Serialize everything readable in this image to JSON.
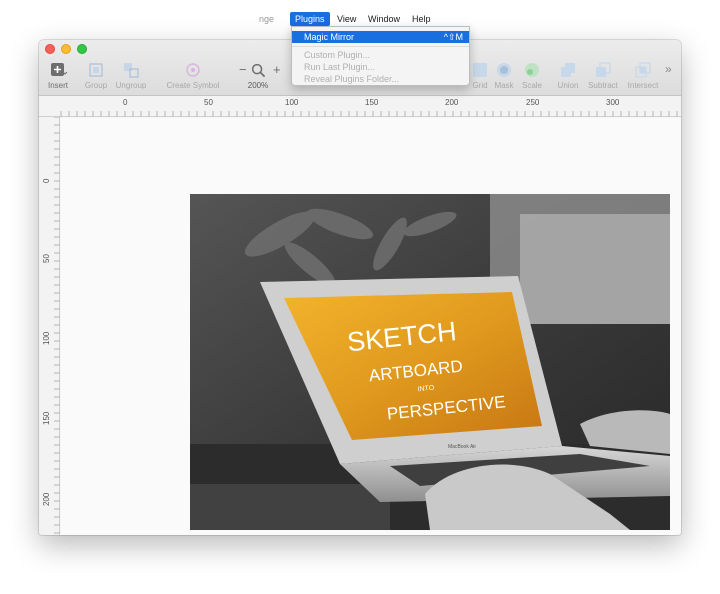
{
  "menubar": {
    "items": [
      {
        "label": "nge"
      },
      {
        "label": "Plugins"
      },
      {
        "label": "View"
      },
      {
        "label": "Window"
      },
      {
        "label": "Help"
      }
    ]
  },
  "plugins_menu": {
    "items": [
      {
        "label": "Magic Mirror",
        "shortcut": "^⇧M"
      },
      {
        "label": "Custom Plugin..."
      },
      {
        "label": "Run Last Plugin..."
      },
      {
        "label": "Reveal Plugins Folder..."
      }
    ]
  },
  "toolbar": {
    "insert": "Insert",
    "group": "Group",
    "ungroup": "Ungroup",
    "create_symbol": "Create Symbol",
    "zoom_minus": "−",
    "zoom_plus": "+",
    "zoom_level": "200%",
    "grid": "Grid",
    "mask": "Mask",
    "scale": "Scale",
    "union": "Union",
    "subtract": "Subtract",
    "intersect": "Intersect",
    "more": "»"
  },
  "ruler": {
    "h_labels": [
      "0",
      "50",
      "100",
      "150",
      "200",
      "250",
      "300"
    ],
    "v_labels": [
      "0",
      "50",
      "100",
      "150",
      "200"
    ]
  },
  "artboard": {
    "screen_text": [
      "SKETCH",
      "ARTBOARD",
      "INTO",
      "PERSPECTIVE"
    ],
    "laptop_label": "MacBook Air"
  },
  "colors": {
    "accent": "#1a6fe0",
    "screen_orange": "#e09a1e"
  }
}
